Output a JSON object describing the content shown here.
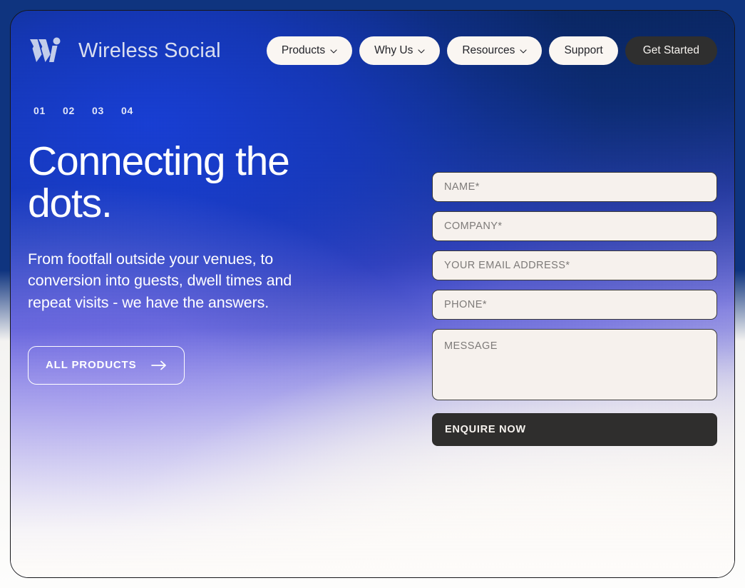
{
  "brand": {
    "name": "Wireless Social",
    "logo_icon": "wireless-social-w-mark"
  },
  "nav": {
    "items": [
      {
        "label": "Products",
        "has_dropdown": true,
        "style": "light"
      },
      {
        "label": "Why Us",
        "has_dropdown": true,
        "style": "light"
      },
      {
        "label": "Resources",
        "has_dropdown": true,
        "style": "light"
      },
      {
        "label": "Support",
        "has_dropdown": false,
        "style": "light"
      },
      {
        "label": "Get Started",
        "has_dropdown": false,
        "style": "dark"
      }
    ]
  },
  "slider": {
    "indicators": [
      "01",
      "02",
      "03",
      "04"
    ],
    "active_index": 0
  },
  "hero": {
    "title": "Connecting the\ndots.",
    "subtitle": "From footfall outside your venues, to conversion into guests, dwell times and repeat visits - we have the answers.",
    "cta_label": "ALL PRODUCTS",
    "cta_icon": "arrow-right-icon"
  },
  "form": {
    "fields": [
      {
        "name": "name",
        "placeholder": "NAME*",
        "value": "",
        "type": "text"
      },
      {
        "name": "company",
        "placeholder": "COMPANY*",
        "value": "",
        "type": "text"
      },
      {
        "name": "email",
        "placeholder": "YOUR EMAIL ADDRESS*",
        "value": "",
        "type": "email"
      },
      {
        "name": "phone",
        "placeholder": "PHONE*",
        "value": "",
        "type": "tel"
      },
      {
        "name": "message",
        "placeholder": "MESSAGE",
        "value": "",
        "type": "textarea"
      }
    ],
    "submit_label": "ENQUIRE NOW"
  },
  "colors": {
    "navy": "#0d2f78",
    "royal_blue": "#183ed6",
    "violet": "#7c70e9",
    "cream": "#f6f1ed",
    "dark_button": "#2f2e2d",
    "brand_text": "#d9def0"
  }
}
